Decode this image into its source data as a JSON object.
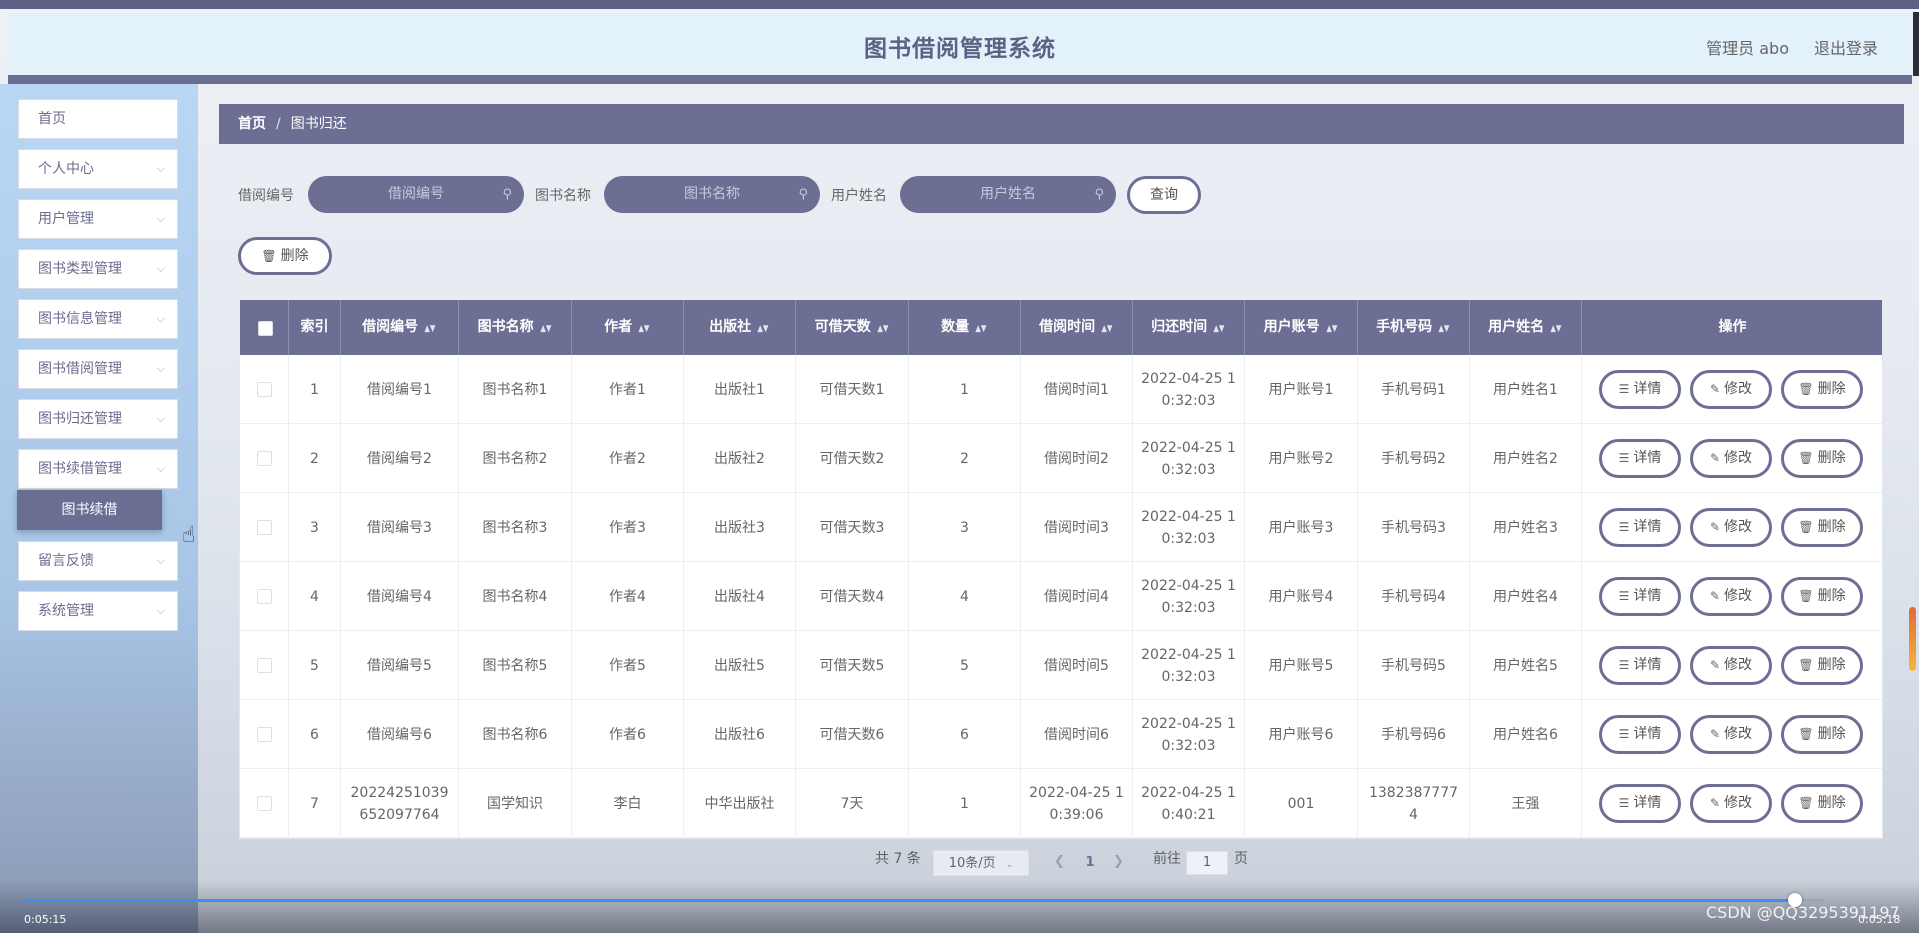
{
  "header": {
    "title": "图书借阅管理系统",
    "admin_label": "管理员 abo",
    "logout_label": "退出登录"
  },
  "sidebar": {
    "items": [
      {
        "label": "首页",
        "has_chevron": false
      },
      {
        "label": "个人中心",
        "has_chevron": true
      },
      {
        "label": "用户管理",
        "has_chevron": true
      },
      {
        "label": "图书类型管理",
        "has_chevron": true
      },
      {
        "label": "图书信息管理",
        "has_chevron": true
      },
      {
        "label": "图书借阅管理",
        "has_chevron": true
      },
      {
        "label": "图书归还管理",
        "has_chevron": true
      },
      {
        "label": "图书续借管理",
        "has_chevron": true
      },
      {
        "label": "留言反馈",
        "has_chevron": true
      },
      {
        "label": "系统管理",
        "has_chevron": true
      }
    ],
    "submenu_label": "图书续借"
  },
  "breadcrumb": {
    "home": "首页",
    "separator": "/",
    "current": "图书归还"
  },
  "search": {
    "borrow_no_label": "借阅编号",
    "borrow_no_placeholder": "借阅编号",
    "book_name_label": "图书名称",
    "book_name_placeholder": "图书名称",
    "user_name_label": "用户姓名",
    "user_name_placeholder": "用户姓名",
    "query_button": "查询"
  },
  "toolbar": {
    "delete_label": "删除"
  },
  "table": {
    "headers": [
      "索引",
      "借阅编号",
      "图书名称",
      "作者",
      "出版社",
      "可借天数",
      "数量",
      "借阅时间",
      "归还时间",
      "用户账号",
      "手机号码",
      "用户姓名",
      "操作"
    ],
    "rows": [
      {
        "index": "1",
        "borrow_no": "借阅编号1",
        "book_name": "图书名称1",
        "author": "作者1",
        "publisher": "出版社1",
        "days": "可借天数1",
        "qty": "1",
        "borrow_time": "借阅时间1",
        "return_time": "2022-04-25 10:32:03",
        "account": "用户账号1",
        "phone": "手机号码1",
        "user_name": "用户姓名1"
      },
      {
        "index": "2",
        "borrow_no": "借阅编号2",
        "book_name": "图书名称2",
        "author": "作者2",
        "publisher": "出版社2",
        "days": "可借天数2",
        "qty": "2",
        "borrow_time": "借阅时间2",
        "return_time": "2022-04-25 10:32:03",
        "account": "用户账号2",
        "phone": "手机号码2",
        "user_name": "用户姓名2"
      },
      {
        "index": "3",
        "borrow_no": "借阅编号3",
        "book_name": "图书名称3",
        "author": "作者3",
        "publisher": "出版社3",
        "days": "可借天数3",
        "qty": "3",
        "borrow_time": "借阅时间3",
        "return_time": "2022-04-25 10:32:03",
        "account": "用户账号3",
        "phone": "手机号码3",
        "user_name": "用户姓名3"
      },
      {
        "index": "4",
        "borrow_no": "借阅编号4",
        "book_name": "图书名称4",
        "author": "作者4",
        "publisher": "出版社4",
        "days": "可借天数4",
        "qty": "4",
        "borrow_time": "借阅时间4",
        "return_time": "2022-04-25 10:32:03",
        "account": "用户账号4",
        "phone": "手机号码4",
        "user_name": "用户姓名4"
      },
      {
        "index": "5",
        "borrow_no": "借阅编号5",
        "book_name": "图书名称5",
        "author": "作者5",
        "publisher": "出版社5",
        "days": "可借天数5",
        "qty": "5",
        "borrow_time": "借阅时间5",
        "return_time": "2022-04-25 10:32:03",
        "account": "用户账号5",
        "phone": "手机号码5",
        "user_name": "用户姓名5"
      },
      {
        "index": "6",
        "borrow_no": "借阅编号6",
        "book_name": "图书名称6",
        "author": "作者6",
        "publisher": "出版社6",
        "days": "可借天数6",
        "qty": "6",
        "borrow_time": "借阅时间6",
        "return_time": "2022-04-25 10:32:03",
        "account": "用户账号6",
        "phone": "手机号码6",
        "user_name": "用户姓名6"
      },
      {
        "index": "7",
        "borrow_no": "20224251039652097764",
        "book_name": "国学知识",
        "author": "李白",
        "publisher": "中华出版社",
        "days": "7天",
        "qty": "1",
        "borrow_time": "2022-04-25 10:39:06",
        "return_time": "2022-04-25 10:40:21",
        "account": "001",
        "phone": "13823877774",
        "user_name": "王强"
      }
    ],
    "actions": {
      "detail": "详情",
      "edit": "修改",
      "delete": "删除"
    }
  },
  "pagination": {
    "total_text": "共 7 条",
    "page_size": "10条/页",
    "current_page": "1",
    "goto_label": "前往",
    "goto_value": "1",
    "page_suffix": "页"
  },
  "player": {
    "time_elapsed": "0:05:15",
    "time_total": "0:05:18",
    "progress": 0.984
  },
  "watermark": "CSDN @QQ3295391197"
}
